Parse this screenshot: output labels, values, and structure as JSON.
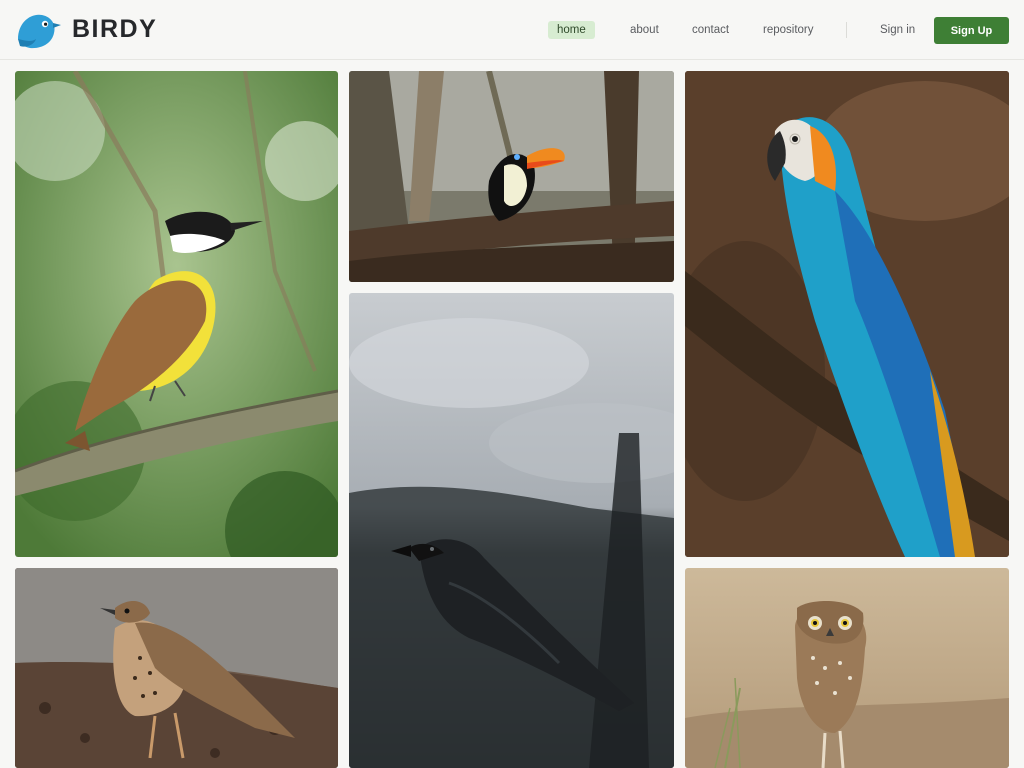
{
  "brand": {
    "name": "BIRDY",
    "logo_icon": "bird-logo-icon",
    "accent": "#2f9ed6"
  },
  "nav": {
    "items": [
      {
        "label": "home",
        "active": true
      },
      {
        "label": "about",
        "active": false
      },
      {
        "label": "contact",
        "active": false
      },
      {
        "label": "repository",
        "active": false
      }
    ],
    "signin_label": "Sign in",
    "signup_label": "Sign Up"
  },
  "colors": {
    "primary_button": "#3e7f35",
    "active_nav_bg": "#d7ecd1",
    "page_bg": "#f7f7f5"
  },
  "gallery": {
    "photos": [
      {
        "subject": "kiskadee"
      },
      {
        "subject": "toucan"
      },
      {
        "subject": "macaw"
      },
      {
        "subject": "thrush"
      },
      {
        "subject": "raven"
      },
      {
        "subject": "owl"
      }
    ]
  }
}
